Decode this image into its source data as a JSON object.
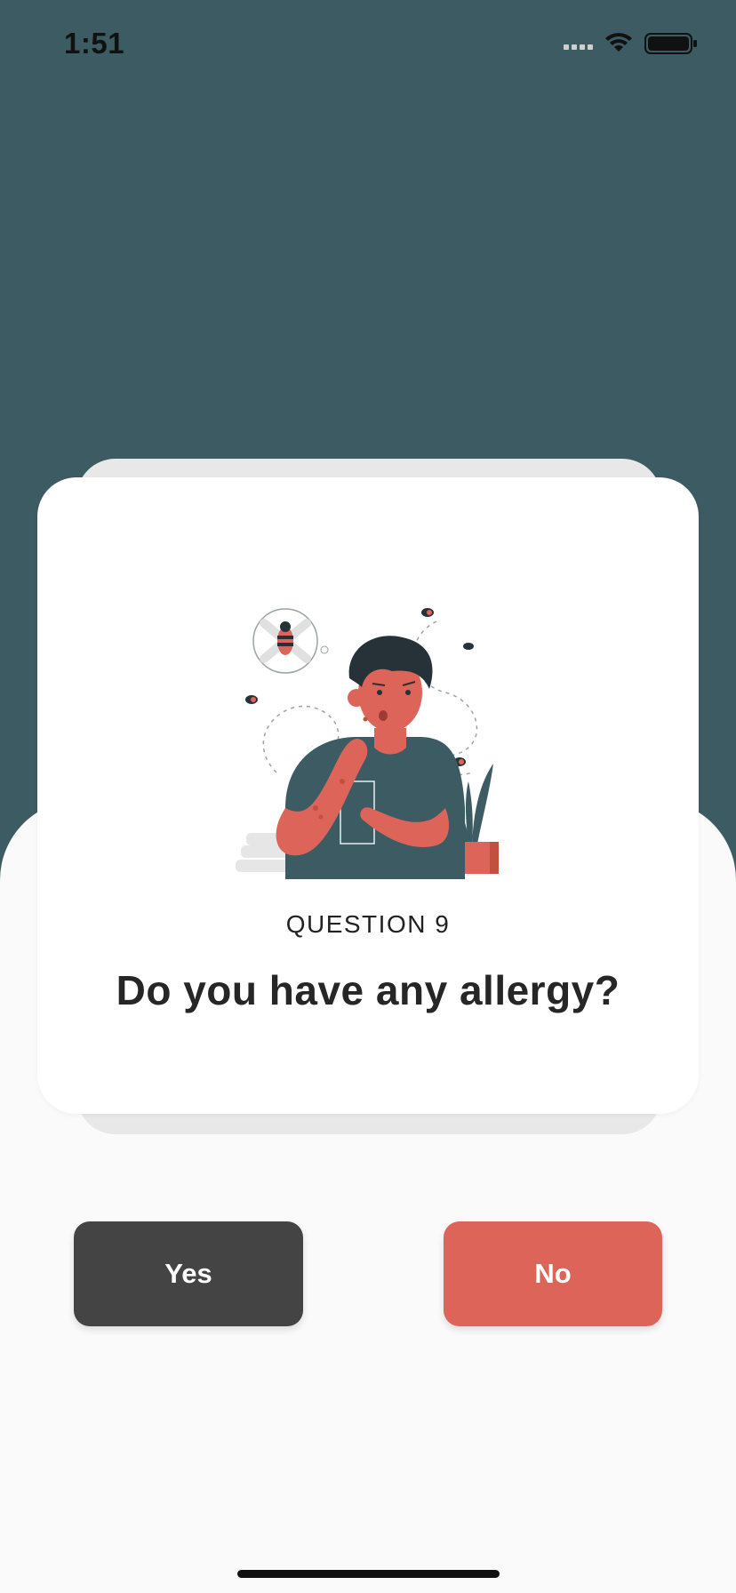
{
  "status_bar": {
    "time": "1:51",
    "icons": [
      "cellular-signal-icon",
      "wifi-icon",
      "battery-icon"
    ]
  },
  "question": {
    "label": "QUESTION 9",
    "text": "Do you have any allergy?",
    "illustration": "allergy-illustration"
  },
  "buttons": {
    "yes_label": "Yes",
    "no_label": "No"
  },
  "colors": {
    "header_background": "#3d5b62",
    "page_background": "#fafafa",
    "yes_button": "#444444",
    "no_button": "#dd6459"
  }
}
